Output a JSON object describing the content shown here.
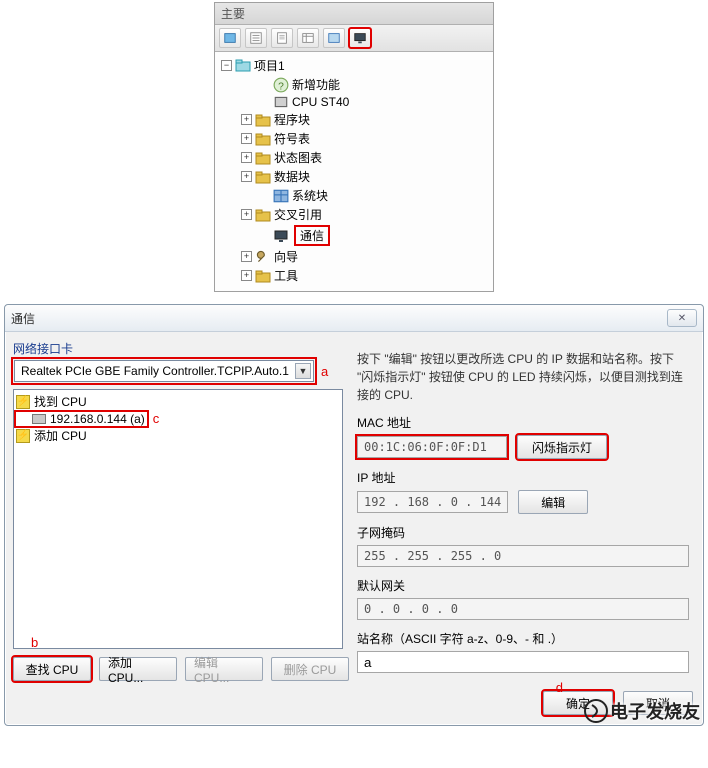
{
  "top": {
    "title": "主要",
    "project": "项目1",
    "nodes": {
      "new_feature": "新增功能",
      "cpu_model": "CPU ST40",
      "program_block": "程序块",
      "symbol_table": "符号表",
      "status_chart": "状态图表",
      "data_block": "数据块",
      "system_block": "系统块",
      "cross_ref": "交叉引用",
      "communication": "通信",
      "wizard": "向导",
      "tools": "工具"
    }
  },
  "dialog": {
    "title": "通信",
    "nic_label": "网络接口卡",
    "nic_value": "Realtek PCIe GBE Family Controller.TCPIP.Auto.1",
    "ann_a": "a",
    "ann_b": "b",
    "ann_c": "c",
    "ann_d": "d",
    "found_cpu": "找到 CPU",
    "ip_item": "192.168.0.144 (a)",
    "add_cpu_item": "添加 CPU",
    "btn_find": "查找 CPU",
    "btn_add": "添加 CPU...",
    "btn_edit": "编辑 CPU...",
    "btn_delete": "删除 CPU",
    "desc": "按下 \"编辑\" 按钮以更改所选 CPU 的 IP 数据和站名称。按下 \"闪烁指示灯\" 按钮使 CPU 的 LED 持续闪烁，以便目测找到连接的 CPU.",
    "mac_label": "MAC 地址",
    "mac_value": "00:1C:06:0F:0F:D1",
    "btn_flash": "闪烁指示灯",
    "ip_label": "IP 地址",
    "ip_value": "192 . 168 .  0  . 144",
    "btn_editip": "编辑",
    "subnet_label": "子网掩码",
    "subnet_value": "255 . 255 . 255 .  0",
    "gateway_label": "默认网关",
    "gateway_value": "0  .  0  .  0  .  0",
    "station_label": "站名称（ASCII 字符 a-z、0-9、- 和 .）",
    "station_value": "a",
    "btn_ok": "确定",
    "btn_cancel": "取消"
  },
  "watermark": "电子发烧友"
}
